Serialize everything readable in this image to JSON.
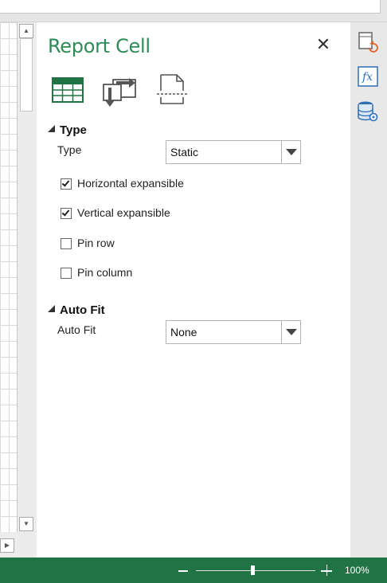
{
  "pane": {
    "title": "Report Cell",
    "close_icon": "close-icon",
    "toolbar": [
      {
        "name": "cell-table-icon",
        "accent": "#217346"
      },
      {
        "name": "data-transfer-icon"
      },
      {
        "name": "page-break-icon"
      }
    ]
  },
  "type_section": {
    "header": "Type",
    "field_label": "Type",
    "selected": "Static",
    "checkboxes": [
      {
        "label": "Horizontal expansible",
        "checked": true
      },
      {
        "label": "Vertical expansible",
        "checked": true
      },
      {
        "label": "Pin row",
        "checked": false
      },
      {
        "label": "Pin column",
        "checked": false
      }
    ]
  },
  "autofit_section": {
    "header": "Auto Fit",
    "field_label": "Auto Fit",
    "selected": "None"
  },
  "side_icons": [
    "cell-refresh-icon",
    "function-icon",
    "database-settings-icon"
  ],
  "status": {
    "zoom_level": "100%",
    "zoom_fraction": 0.47,
    "bar_color": "#217346"
  },
  "colors": {
    "title": "#2e8b57",
    "accent_orange": "#e2632c",
    "accent_blue": "#2e6eb5"
  }
}
